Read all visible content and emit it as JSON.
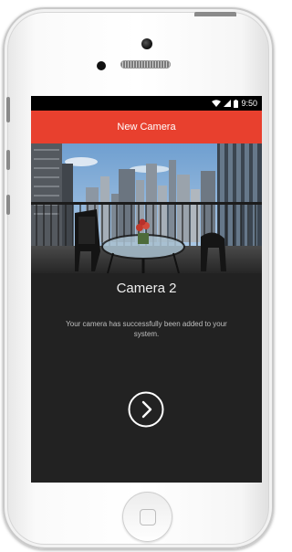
{
  "status_bar": {
    "time": "9:50"
  },
  "app_bar": {
    "title": "New Camera"
  },
  "camera": {
    "name": "Camera 2",
    "message": "Your camera has successfully been added to your system."
  },
  "icons": {
    "wifi": "wifi-icon",
    "signal": "cell-signal-icon",
    "battery": "battery-icon",
    "next": "chevron-right-circle-icon"
  },
  "colors": {
    "accent": "#e8402e",
    "screen_bg": "#222222",
    "status_bar_bg": "#000000"
  }
}
